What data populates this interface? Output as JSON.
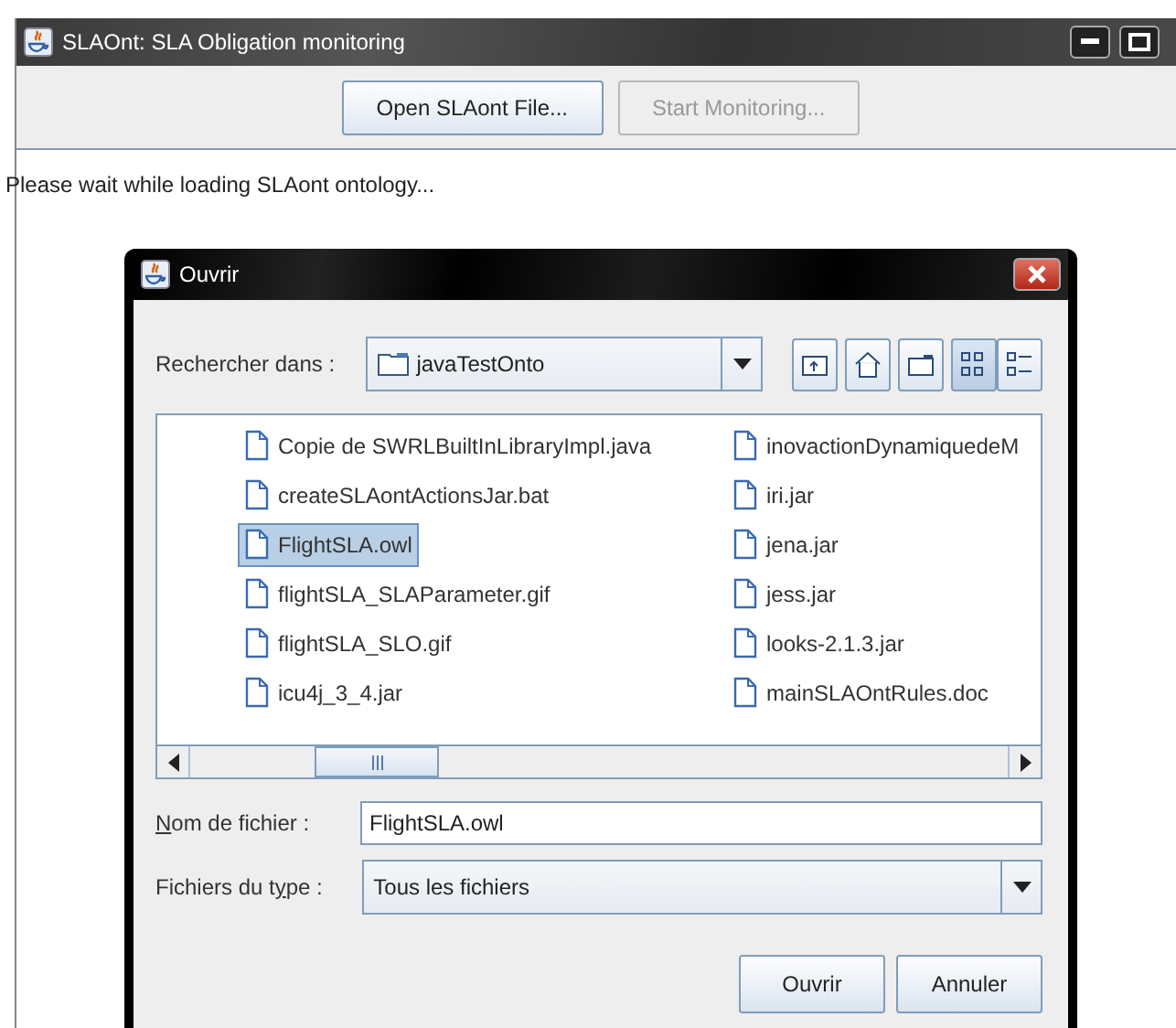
{
  "main_window": {
    "title": "SLAOnt: SLA Obligation monitoring",
    "buttons": [
      {
        "label": "Open SLAont File...",
        "disabled": false
      },
      {
        "label": "Start Monitoring...",
        "disabled": true
      }
    ],
    "status": "Please wait while loading SLAont ontology..."
  },
  "dialog": {
    "title": "Ouvrir",
    "look_in": {
      "label": "Rechercher dans :",
      "value": "javaTestOnto"
    },
    "view_modes": [
      {
        "kind": "list",
        "selected": true
      },
      {
        "kind": "details",
        "selected": false
      }
    ],
    "files": [
      {
        "name": "Copie de SWRLBuiltInLibraryImpl.java",
        "selected": false
      },
      {
        "name": "createSLAontActionsJar.bat",
        "selected": false
      },
      {
        "name": "FlightSLA.owl",
        "selected": true
      },
      {
        "name": "flightSLA_SLAParameter.gif",
        "selected": false
      },
      {
        "name": "flightSLA_SLO.gif",
        "selected": false
      },
      {
        "name": "icu4j_3_4.jar",
        "selected": false
      },
      {
        "name": "inovactionDynamiquedeM",
        "selected": false
      },
      {
        "name": "iri.jar",
        "selected": false
      },
      {
        "name": "jena.jar",
        "selected": false
      },
      {
        "name": "jess.jar",
        "selected": false
      },
      {
        "name": "looks-2.1.3.jar",
        "selected": false
      },
      {
        "name": "mainSLAOntRules.doc",
        "selected": false
      }
    ],
    "file_name": {
      "mnemonic": "N",
      "label_after": "om de fichier :",
      "value": "FlightSLA.owl"
    },
    "file_type": {
      "label_before": "Fichiers du t",
      "mnemonic": "y",
      "label_after": "pe :",
      "value": "Tous les fichiers"
    },
    "buttons": [
      "Ouvrir",
      "Annuler"
    ]
  }
}
